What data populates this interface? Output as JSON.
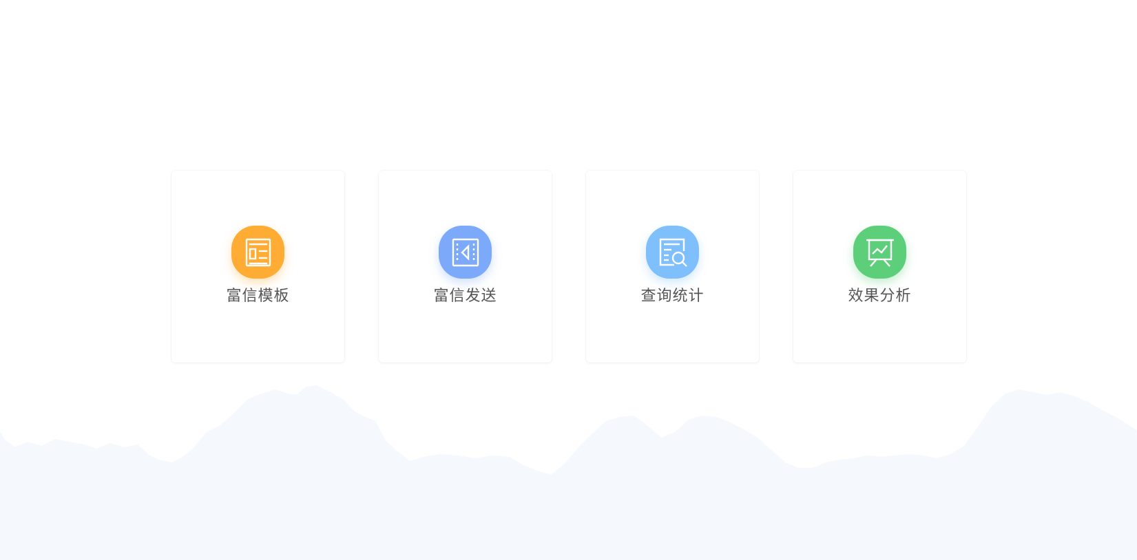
{
  "cards": [
    {
      "label": "富信模板",
      "icon": "template-document-icon",
      "color": "#FFAC35"
    },
    {
      "label": "富信发送",
      "icon": "send-icon",
      "color": "#7DA9FB"
    },
    {
      "label": "查询统计",
      "icon": "search-report-icon",
      "color": "#7EBFFC"
    },
    {
      "label": "效果分析",
      "icon": "presentation-chart-icon",
      "color": "#5DCF7B"
    }
  ],
  "background": {
    "cloud_color": "#F5F8FD"
  }
}
